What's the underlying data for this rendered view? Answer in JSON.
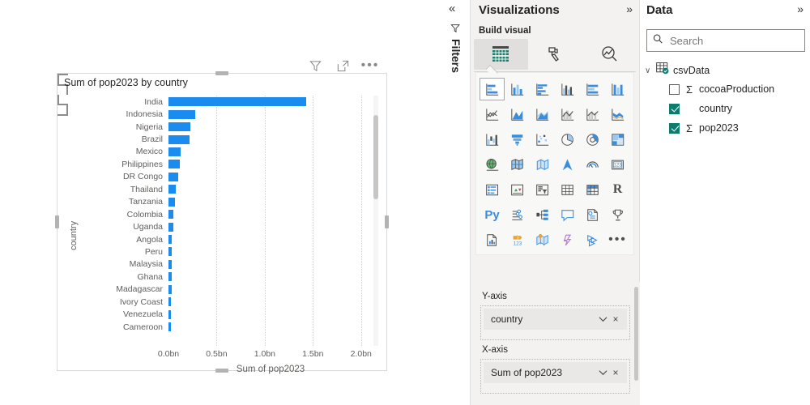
{
  "canvas": {
    "visual_header": {
      "filter_icon": "filter-icon",
      "focus_icon": "focus-mode-icon",
      "more_label": "•••"
    },
    "visual": {
      "title": "Sum of pop2023 by country",
      "y_axis_title": "country",
      "x_axis_title": "Sum of pop2023"
    }
  },
  "chart_data": {
    "type": "bar",
    "orientation": "horizontal",
    "title": "Sum of pop2023 by country",
    "xlabel": "Sum of pop2023",
    "ylabel": "country",
    "xlim": [
      0,
      2.12
    ],
    "x_tick_labels": [
      "0.0bn",
      "0.5bn",
      "1.0bn",
      "1.5bn",
      "2.0bn"
    ],
    "x_tick_values": [
      0,
      0.5,
      1.0,
      1.5,
      2.0
    ],
    "grid": true,
    "legend": "none",
    "units": "billions",
    "bar_color": "#1a8cf0",
    "categories": [
      "India",
      "Indonesia",
      "Nigeria",
      "Brazil",
      "Mexico",
      "Philippines",
      "DR Congo",
      "Thailand",
      "Tanzania",
      "Colombia",
      "Uganda",
      "Angola",
      "Peru",
      "Malaysia",
      "Ghana",
      "Madagascar",
      "Ivory Coast",
      "Venezuela",
      "Cameroon"
    ],
    "values": [
      1.428,
      0.278,
      0.224,
      0.216,
      0.128,
      0.117,
      0.102,
      0.072,
      0.067,
      0.052,
      0.048,
      0.036,
      0.034,
      0.034,
      0.034,
      0.03,
      0.028,
      0.028,
      0.028
    ]
  },
  "filters_rail": {
    "collapse_icon": "«",
    "filter_icon": "filter-arrow-icon",
    "label": "Filters"
  },
  "visualizations": {
    "title": "Visualizations",
    "expand_icon": "»",
    "section_label": "Build visual",
    "tabs": [
      {
        "name": "build-visual-tab",
        "icon": "table-grid-icon",
        "selected": true
      },
      {
        "name": "format-visual-tab",
        "icon": "paint-roller-icon",
        "selected": false
      },
      {
        "name": "analytics-tab",
        "icon": "magnifier-chart-icon",
        "selected": false
      }
    ],
    "gallery": [
      {
        "name": "stacked-bar-chart",
        "icon": "stacked-bar-icon",
        "selected": true
      },
      {
        "name": "stacked-column-chart",
        "icon": "stacked-column-icon",
        "selected": false
      },
      {
        "name": "clustered-bar-chart",
        "icon": "clustered-bar-icon",
        "selected": false
      },
      {
        "name": "clustered-column-chart",
        "icon": "clustered-column-icon",
        "selected": false
      },
      {
        "name": "hundred-percent-stacked-bar-chart",
        "icon": "pct-stacked-bar-icon",
        "selected": false
      },
      {
        "name": "hundred-percent-stacked-column-chart",
        "icon": "pct-stacked-column-icon",
        "selected": false
      },
      {
        "name": "line-chart",
        "icon": "line-chart-icon",
        "selected": false
      },
      {
        "name": "area-chart",
        "icon": "area-chart-icon",
        "selected": false
      },
      {
        "name": "stacked-area-chart",
        "icon": "stacked-area-icon",
        "selected": false
      },
      {
        "name": "line-stacked-column-chart",
        "icon": "line-stacked-column-icon",
        "selected": false
      },
      {
        "name": "line-clustered-column-chart",
        "icon": "line-clustered-column-icon",
        "selected": false
      },
      {
        "name": "ribbon-chart",
        "icon": "ribbon-chart-icon",
        "selected": false
      },
      {
        "name": "waterfall-chart",
        "icon": "waterfall-icon",
        "selected": false
      },
      {
        "name": "funnel-chart",
        "icon": "funnel-icon",
        "selected": false
      },
      {
        "name": "scatter-chart",
        "icon": "scatter-icon",
        "selected": false
      },
      {
        "name": "pie-chart",
        "icon": "pie-icon",
        "selected": false
      },
      {
        "name": "donut-chart",
        "icon": "donut-icon",
        "selected": false
      },
      {
        "name": "treemap-chart",
        "icon": "treemap-icon",
        "selected": false
      },
      {
        "name": "map-visual",
        "icon": "globe-map-icon",
        "selected": false
      },
      {
        "name": "filled-map-visual",
        "icon": "filled-map-icon",
        "selected": false
      },
      {
        "name": "shape-map-visual",
        "icon": "shape-map-icon",
        "selected": false
      },
      {
        "name": "azure-map-visual",
        "icon": "azure-map-arrow-icon",
        "selected": false
      },
      {
        "name": "gauge-visual",
        "icon": "gauge-icon",
        "selected": false
      },
      {
        "name": "card-visual",
        "icon": "card-123-icon",
        "selected": false
      },
      {
        "name": "multi-row-card-visual",
        "icon": "multi-row-card-icon",
        "selected": false
      },
      {
        "name": "kpi-visual",
        "icon": "kpi-icon",
        "selected": false
      },
      {
        "name": "slicer-visual",
        "icon": "slicer-filter-icon",
        "selected": false
      },
      {
        "name": "table-visual",
        "icon": "table-icon",
        "selected": false
      },
      {
        "name": "matrix-visual",
        "icon": "matrix-icon",
        "selected": false
      },
      {
        "name": "r-script-visual",
        "icon": "r-script-icon",
        "selected": false
      },
      {
        "name": "python-visual",
        "icon": "python-icon",
        "selected": false
      },
      {
        "name": "key-influencers-visual",
        "icon": "key-influencers-icon",
        "selected": false
      },
      {
        "name": "decomposition-tree-visual",
        "icon": "decomposition-tree-icon",
        "selected": false
      },
      {
        "name": "qa-visual",
        "icon": "qa-bubble-icon",
        "selected": false
      },
      {
        "name": "smart-narrative-visual",
        "icon": "smart-narrative-icon",
        "selected": false
      },
      {
        "name": "metrics-visual",
        "icon": "trophy-icon",
        "selected": false
      },
      {
        "name": "paginated-report-visual",
        "icon": "paginated-report-icon",
        "selected": false
      },
      {
        "name": "power-apps-visual",
        "icon": "power-apps-icon",
        "selected": false
      },
      {
        "name": "arcgis-maps-visual",
        "icon": "arcgis-map-icon",
        "selected": false
      },
      {
        "name": "power-automate-visual",
        "icon": "power-automate-icon",
        "selected": false
      },
      {
        "name": "visio-visual",
        "icon": "visio-icon",
        "selected": false
      },
      {
        "name": "more-visuals",
        "icon": "ellipsis-icon",
        "selected": false
      }
    ],
    "wells": [
      {
        "label": "Y-axis",
        "field": "country",
        "dropdown_icon": "chevron-down-icon",
        "remove_icon": "×"
      },
      {
        "label": "X-axis",
        "field": "Sum of pop2023",
        "dropdown_icon": "chevron-down-icon",
        "remove_icon": "×"
      }
    ]
  },
  "data_pane": {
    "title": "Data",
    "expand_icon": "»",
    "search": {
      "placeholder": "Search",
      "value": "",
      "icon": "search-icon"
    },
    "table": {
      "name": "csvData",
      "expand_icon": "∨",
      "table_icon": "table-data-icon",
      "fields": [
        {
          "name": "cocoaProduction",
          "checked": false,
          "aggregate": true
        },
        {
          "name": "country",
          "checked": true,
          "aggregate": false
        },
        {
          "name": "pop2023",
          "checked": true,
          "aggregate": true
        }
      ]
    }
  },
  "colors": {
    "bar": "#1a8cf0",
    "accent_teal": "#0f7b6c",
    "pane_bg": "#f3f2f1",
    "text": "#252423",
    "muted_text": "#605e5c"
  }
}
